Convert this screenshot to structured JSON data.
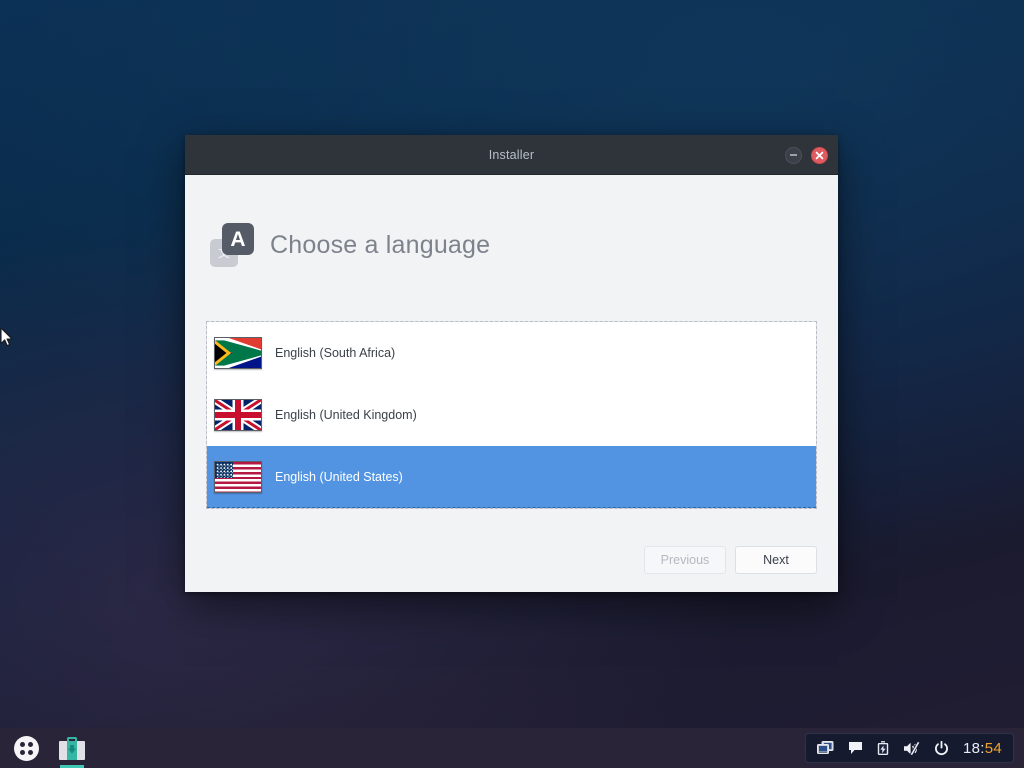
{
  "window": {
    "title": "Installer",
    "minimize_label": "minimize",
    "close_label": "close"
  },
  "page": {
    "title": "Choose a language",
    "icon_front_char": "A",
    "icon_back_char": "文"
  },
  "languages": [
    {
      "label": "English (South Africa)",
      "flag": "flag-south-africa",
      "selected": false
    },
    {
      "label": "English (United Kingdom)",
      "flag": "flag-united-kingdom",
      "selected": false
    },
    {
      "label": "English (United States)",
      "flag": "flag-united-states",
      "selected": true
    }
  ],
  "navigation": {
    "previous_label": "Previous",
    "next_label": "Next"
  },
  "taskbar": {
    "app_menu_label": "Applications",
    "installer_task_label": "Installer",
    "tray": {
      "display_icon": "display-icon",
      "chat_icon": "chat-icon",
      "battery_icon": "battery-charging-icon",
      "volume_icon": "volume-muted-icon",
      "power_icon": "power-icon"
    },
    "clock": {
      "hours": "18",
      "separator": ":",
      "minutes": "54",
      "full": "18:54"
    }
  },
  "colors": {
    "titlebar": "#2f343b",
    "window_body": "#f2f3f5",
    "selection": "#5294e2",
    "close_button": "#e05c61",
    "taskbar": "#2a2438",
    "tray_background": "#161a2e",
    "clock_minutes": "#f0a32a",
    "installer_accent": "#35b5a4"
  }
}
